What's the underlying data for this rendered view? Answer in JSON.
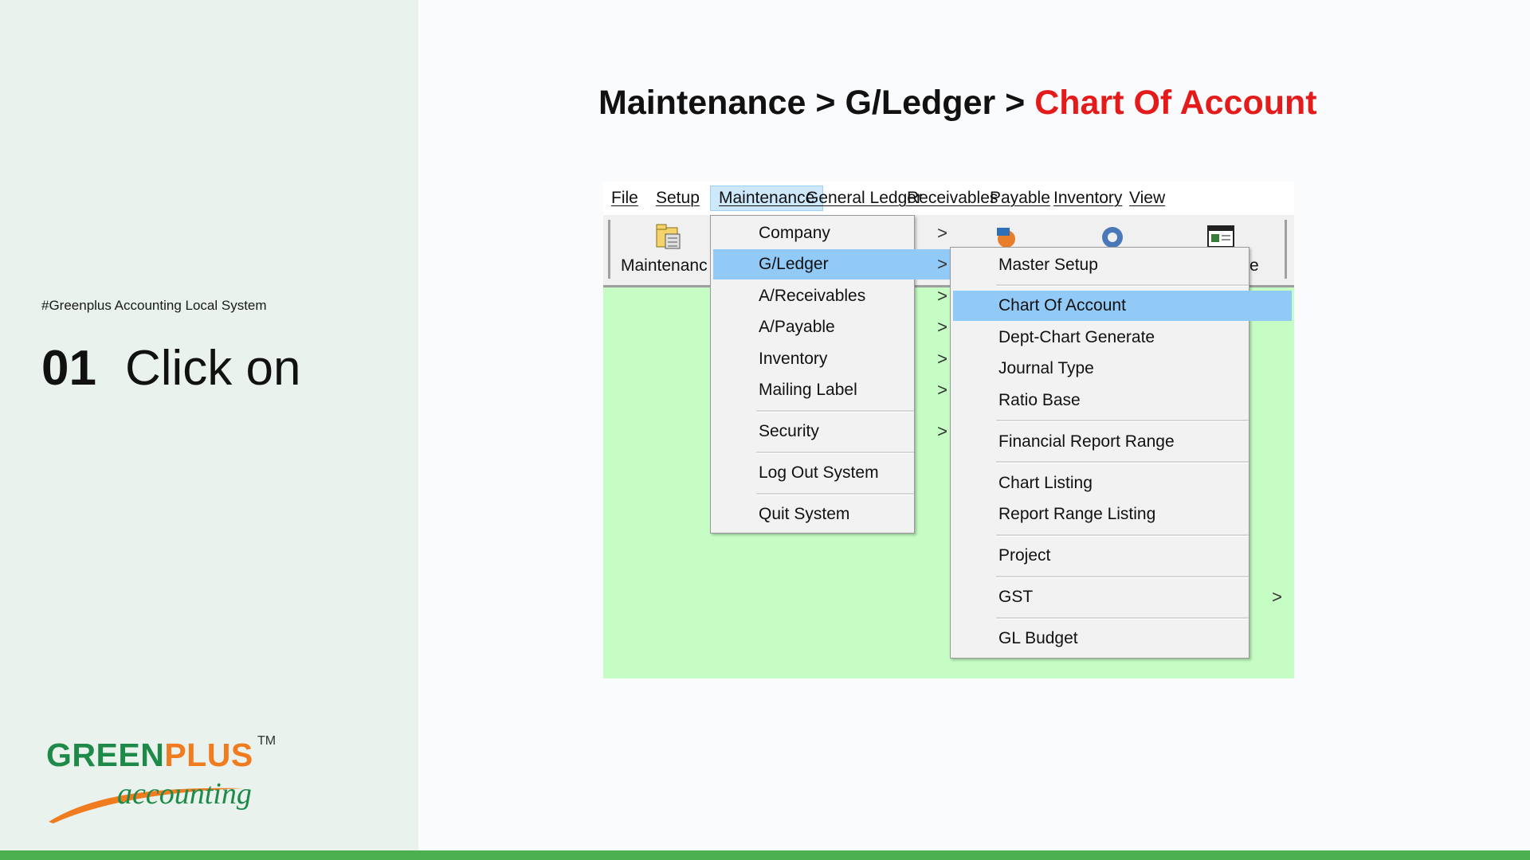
{
  "sidebar": {
    "tagline": "#Greenplus Accounting Local System",
    "step_number": "01",
    "step_text": "Click on",
    "logo": {
      "main_green": "GREEN",
      "main_orange": "PLUS",
      "tm": "TM",
      "sub": "accounting"
    }
  },
  "headline": {
    "part1": "Maintenance > G/Ledger > ",
    "part2": "Chart Of Account"
  },
  "app": {
    "menubar": [
      "File",
      "Setup",
      "Maintenance",
      "General Ledger",
      "Receivables",
      "Payable",
      "Inventory",
      "View"
    ],
    "active_menu": "Maintenance",
    "toolbar": {
      "left_label": "Maintenanc",
      "right_label": "e"
    },
    "maintenance_menu": [
      {
        "label": "Company",
        "submenu": true
      },
      {
        "label": "G/Ledger",
        "submenu": true,
        "highlighted": true
      },
      {
        "label": "A/Receivables",
        "submenu": true
      },
      {
        "label": "A/Payable",
        "submenu": true
      },
      {
        "label": "Inventory",
        "submenu": true
      },
      {
        "label": "Mailing Label",
        "submenu": true
      },
      {
        "label": "Security",
        "submenu": true
      },
      {
        "label": "Log Out System",
        "submenu": false
      },
      {
        "label": "Quit System",
        "submenu": false
      }
    ],
    "gledger_menu": [
      {
        "label": "Master Setup"
      },
      {
        "label": "Chart Of Account",
        "highlighted": true
      },
      {
        "label": "Dept-Chart Generate"
      },
      {
        "label": "Journal Type"
      },
      {
        "label": "Ratio Base"
      },
      {
        "label": "Financial Report Range"
      },
      {
        "label": "Chart Listing"
      },
      {
        "label": "Report Range Listing"
      },
      {
        "label": "Project"
      },
      {
        "label": "GST",
        "submenu": true
      },
      {
        "label": "GL Budget"
      }
    ],
    "arrow_glyph": ">"
  },
  "colors": {
    "headline_accent": "#e31b1b",
    "menu_highlight": "#91c9f7",
    "app_background": "#c5fdc5",
    "bottom_bar": "#4caf50",
    "brand_green": "#1e8a4a",
    "brand_orange": "#f07c1f"
  }
}
